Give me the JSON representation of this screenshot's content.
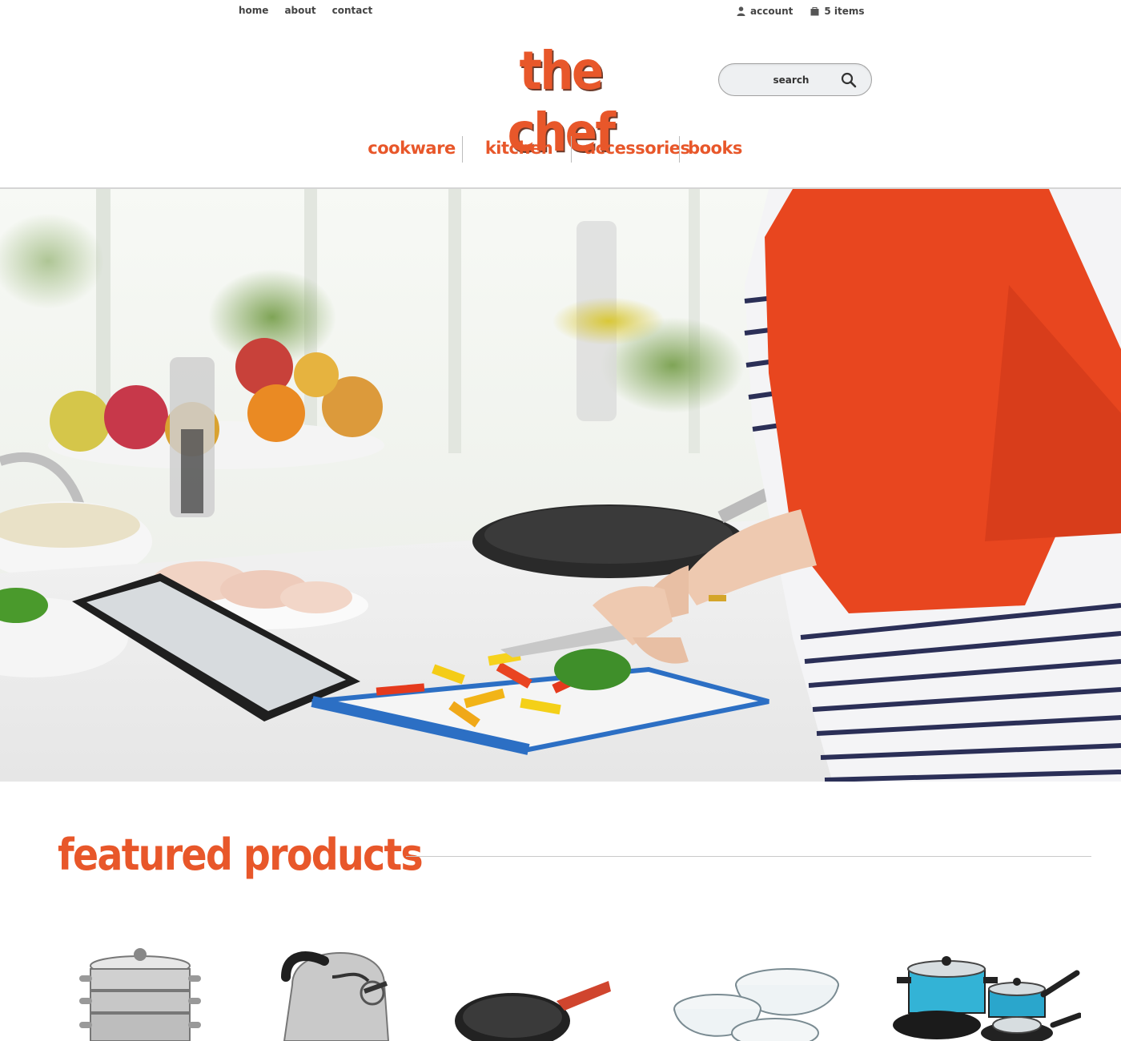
{
  "top_nav": {
    "links": [
      {
        "label": "home"
      },
      {
        "label": "about"
      },
      {
        "label": "contact"
      }
    ],
    "account_label": "account",
    "account_icon": "user-icon",
    "cart_label": "5 items",
    "cart_icon": "cart-icon"
  },
  "brand": {
    "name": "the chef",
    "color": "#e8572a"
  },
  "search": {
    "placeholder": "search",
    "icon": "search-icon"
  },
  "main_nav": {
    "items": [
      {
        "label": "cookware"
      },
      {
        "label": "kitchen"
      },
      {
        "label": "accessories"
      },
      {
        "label": "books"
      }
    ]
  },
  "hero": {
    "image": "woman-cutting-vegetables-in-kitchen"
  },
  "featured": {
    "title": "featured products",
    "products": [
      {
        "image": "steamer-pot-icon"
      },
      {
        "image": "kettle-icon"
      },
      {
        "image": "frying-pan-icon"
      },
      {
        "image": "glass-bowls-icon"
      },
      {
        "image": "cookware-set-icon"
      }
    ]
  }
}
